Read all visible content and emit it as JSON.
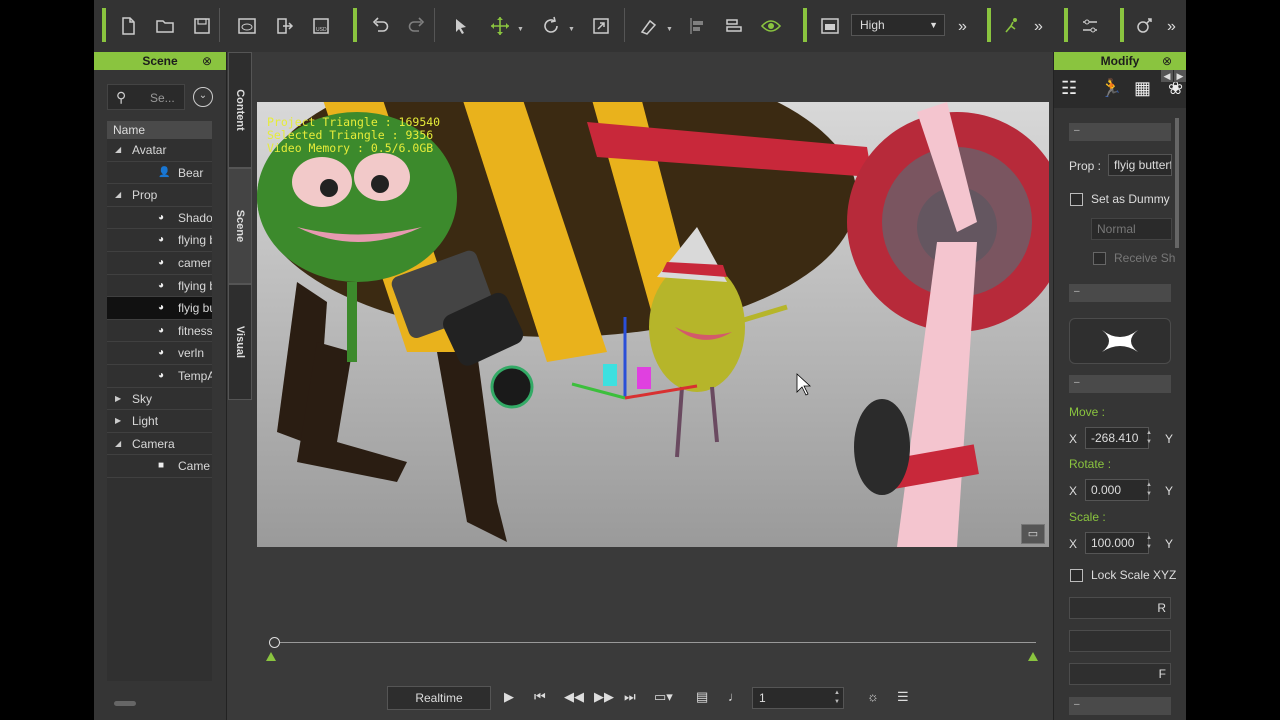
{
  "toolbar": {
    "quality": "High",
    "more": "»",
    "icons": [
      "new-file",
      "open-folder",
      "save",
      "preview",
      "export",
      "export-usd",
      "undo",
      "redo",
      "select",
      "move",
      "rotate",
      "scale",
      "align-tool",
      "align-left",
      "align-distribute",
      "visibility",
      "layout",
      "motion",
      "settings",
      "transform"
    ]
  },
  "scene": {
    "title": "Scene",
    "close": "⊗",
    "search_placeholder": "Se...",
    "column": "Name",
    "tree": {
      "avatar": "Avatar",
      "bear": "Bear",
      "prop": "Prop",
      "props": [
        "Shado",
        "flying b",
        "camer",
        "flying b",
        "flyig bu",
        "fitness",
        "verln",
        "TempA"
      ],
      "sky": "Sky",
      "light": "Light",
      "camera": "Camera",
      "camera_child": "Came"
    }
  },
  "side_tabs": {
    "content": "Content",
    "scene": "Scene",
    "visual": "Visual"
  },
  "viewport": {
    "stats": {
      "line1": "Project Triangle : 169540",
      "line2": "Selected Triangle : 9356",
      "line3": "Video Memory : 0.5/6.0GB"
    },
    "chat_icon": "▭"
  },
  "playback": {
    "mode": "Realtime",
    "frame": "1",
    "icons": [
      "play",
      "to-start",
      "prev-frame",
      "next-frame",
      "to-end",
      "loop",
      "subtitle",
      "music",
      "settings",
      "list"
    ]
  },
  "modify": {
    "title": "Modify",
    "close": "⊗",
    "collapse": "–",
    "prop_label": "Prop :",
    "prop_value": "flyig butterf",
    "set_as_dummy": "Set as Dummy",
    "normal": "Normal",
    "receive_shadow": "Receive Sh",
    "move_label": "Move :",
    "rotate_label": "Rotate :",
    "scale_label": "Scale :",
    "x_label": "X",
    "y_label": "Y",
    "move_x": "-268.410",
    "rotate_x": "0.000",
    "scale_x": "100.000",
    "lock_scale": "Lock Scale XYZ",
    "btn1": "R",
    "btn3": "F"
  },
  "colors": {
    "accent": "#8ac43f",
    "stats_text": "#e6ec3a",
    "background": "#3a3a3a"
  }
}
